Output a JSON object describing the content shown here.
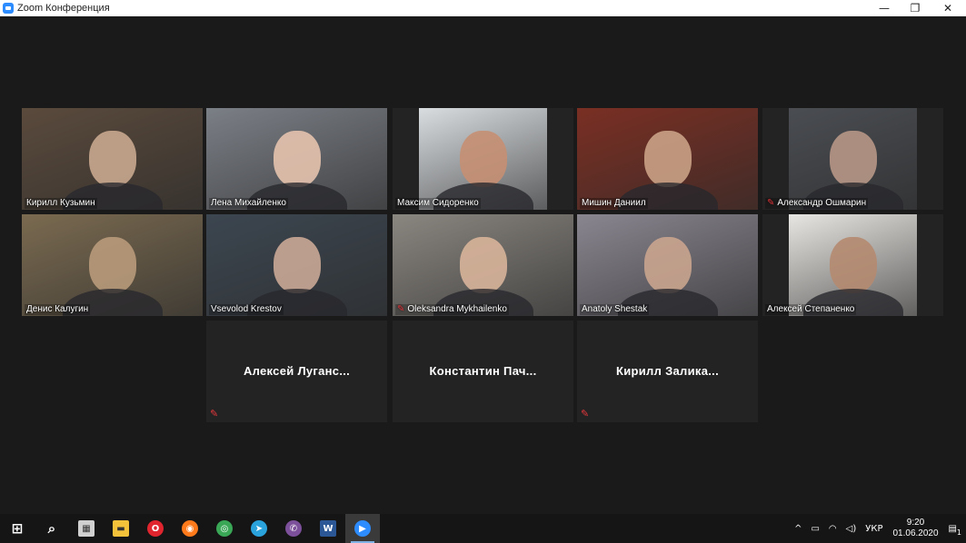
{
  "window": {
    "title": "Zoom Конференция",
    "minimize": "—",
    "restore": "❐",
    "close": "✕"
  },
  "participants_video": [
    {
      "name": "Кирилл Кузьмин",
      "muted": false,
      "bg": "#5a4a3c",
      "face": "#c9a98f"
    },
    {
      "name": "Лена Михайленко",
      "muted": false,
      "bg": "#7b7f86",
      "face": "#e6c3ae",
      "active": true
    },
    {
      "name": "Максим Сидоренко",
      "muted": false,
      "bg": "#d9dde0",
      "face": "#c58f72"
    },
    {
      "name": "Мишин Даниил",
      "muted": false,
      "bg": "#7a2f23",
      "face": "#caa286"
    },
    {
      "name": "Александр Ошмарин",
      "muted": true,
      "bg": "#4a4d52",
      "face": "#b79786"
    },
    {
      "name": "Денис Калугин",
      "muted": false,
      "bg": "#7a6a50",
      "face": "#b89a7a"
    },
    {
      "name": "Vsevolod Krestov",
      "muted": false,
      "bg": "#3c4650",
      "face": "#caa996"
    },
    {
      "name": "Oleksandra Mykhailenko",
      "muted": true,
      "bg": "#8a8680",
      "face": "#d8b49a"
    },
    {
      "name": "Anatoly Shestak",
      "muted": false,
      "bg": "#8a8690",
      "face": "#c9a48e"
    },
    {
      "name": "Алексей Степаненко",
      "muted": false,
      "bg": "#e8e6e2",
      "face": "#b58a70"
    }
  ],
  "participants_audio": [
    {
      "name": "Алексей Луганс...",
      "muted": true
    },
    {
      "name": "Константин Пач...",
      "muted": false
    },
    {
      "name": "Кирилл Залика...",
      "muted": true
    }
  ],
  "taskbar": {
    "apps": [
      {
        "id": "start",
        "color": "#ffffff"
      },
      {
        "id": "search",
        "color": "#ffffff"
      },
      {
        "id": "calculator",
        "color": "#d0d0d0"
      },
      {
        "id": "explorer",
        "color": "#f3c13a"
      },
      {
        "id": "opera",
        "color": "#e0252f"
      },
      {
        "id": "firefox",
        "color": "#ff7a1a"
      },
      {
        "id": "chrome",
        "color": "#3aa757"
      },
      {
        "id": "telegram",
        "color": "#2aa3dd"
      },
      {
        "id": "viber",
        "color": "#7c509a"
      },
      {
        "id": "word",
        "color": "#2b5797"
      },
      {
        "id": "zoom",
        "color": "#2d8cff"
      }
    ],
    "tray": {
      "lang": "УКР",
      "time": "9:20",
      "date": "01.06.2020",
      "notifications": "1"
    }
  }
}
